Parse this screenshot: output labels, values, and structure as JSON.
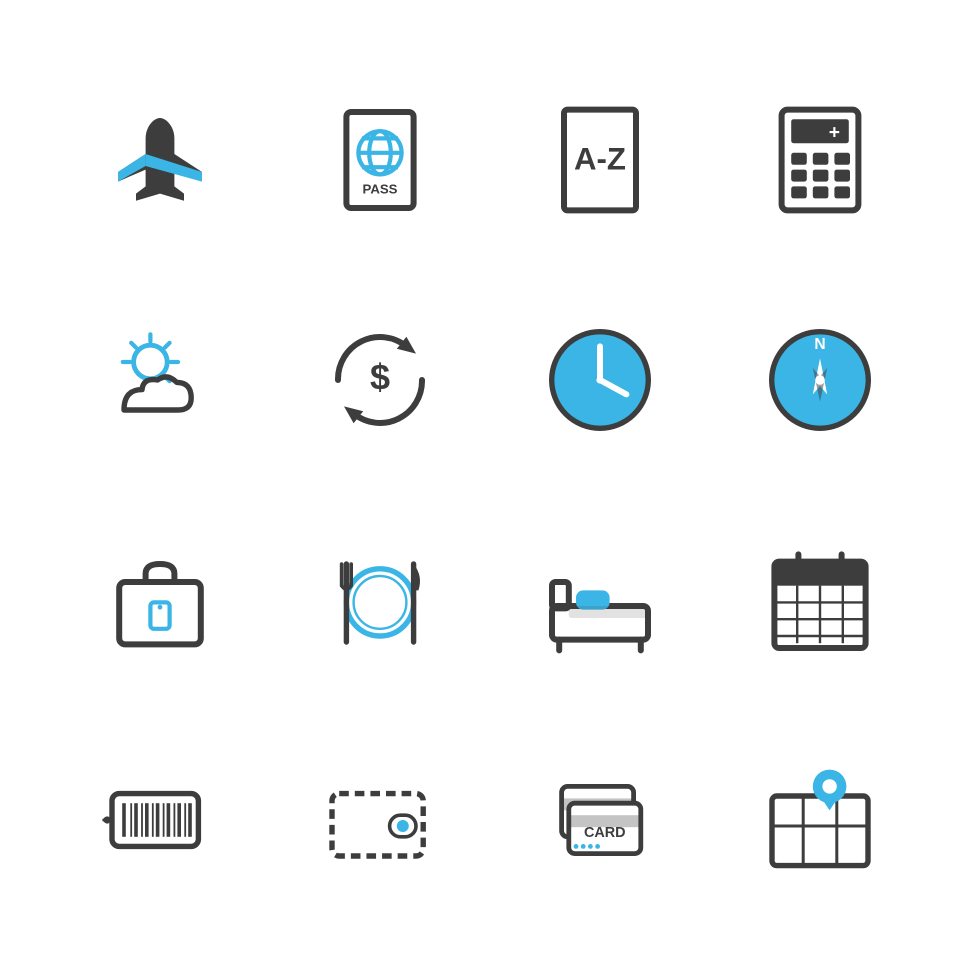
{
  "colors": {
    "dark": "#3d3d3d",
    "blue": "#3ab5e5",
    "white": "#ffffff"
  },
  "icons": [
    {
      "id": "airplane",
      "label": "Airplane"
    },
    {
      "id": "passport",
      "label": "Passport"
    },
    {
      "id": "az-book",
      "label": "A-Z Book"
    },
    {
      "id": "calculator",
      "label": "Calculator"
    },
    {
      "id": "weather",
      "label": "Weather"
    },
    {
      "id": "currency-exchange",
      "label": "Currency Exchange"
    },
    {
      "id": "clock",
      "label": "Clock"
    },
    {
      "id": "compass",
      "label": "Compass"
    },
    {
      "id": "luggage",
      "label": "Luggage"
    },
    {
      "id": "dining",
      "label": "Dining"
    },
    {
      "id": "bed",
      "label": "Hotel Bed"
    },
    {
      "id": "calendar",
      "label": "Calendar"
    },
    {
      "id": "barcode-tag",
      "label": "Barcode Tag"
    },
    {
      "id": "wallet",
      "label": "Wallet"
    },
    {
      "id": "card",
      "label": "Card"
    },
    {
      "id": "map-pin",
      "label": "Map with Pin"
    }
  ]
}
